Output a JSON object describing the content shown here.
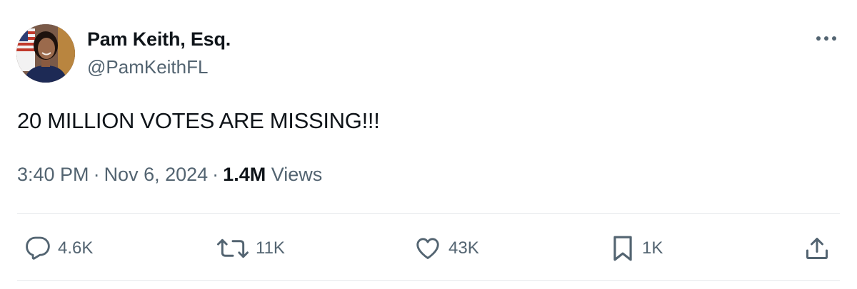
{
  "author": {
    "display_name": "Pam Keith, Esq.",
    "handle": "@PamKeithFL"
  },
  "tweet": {
    "text": "20 MILLION VOTES ARE MISSING!!!",
    "time": "3:40 PM",
    "separator": "·",
    "date": "Nov 6, 2024",
    "views_count": "1.4M",
    "views_label": "Views"
  },
  "actions": {
    "reply": {
      "icon": "reply-icon",
      "count": "4.6K"
    },
    "retweet": {
      "icon": "retweet-icon",
      "count": "11K"
    },
    "like": {
      "icon": "heart-icon",
      "count": "43K"
    },
    "bookmark": {
      "icon": "bookmark-icon",
      "count": "1K"
    },
    "share": {
      "icon": "share-icon"
    }
  },
  "more_menu": {
    "icon": "more-icon"
  },
  "colors": {
    "text_primary": "#0f1419",
    "text_secondary": "#536471",
    "divider": "#e4e7ea",
    "background": "#ffffff"
  }
}
